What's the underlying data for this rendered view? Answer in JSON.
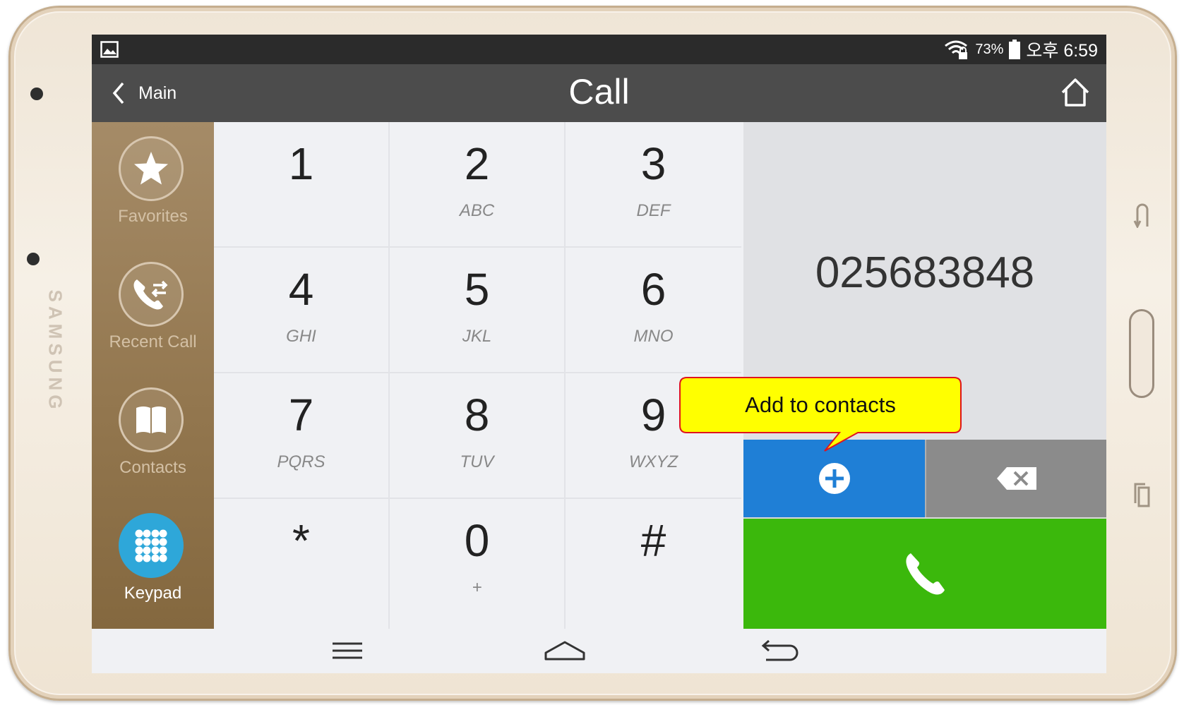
{
  "device": {
    "brand": "SAMSUNG"
  },
  "status_bar": {
    "gallery_icon": "picture-icon",
    "wifi_icon": "wifi-lock-icon",
    "battery_percent": "73%",
    "battery_icon": "battery-icon",
    "time": "오후 6:59"
  },
  "header": {
    "back_label": "Main",
    "title": "Call",
    "home_icon": "home-icon"
  },
  "sidebar": {
    "items": [
      {
        "label": "Favorites",
        "icon": "star-icon",
        "active": false
      },
      {
        "label": "Recent Call",
        "icon": "recent-call-icon",
        "active": false
      },
      {
        "label": "Contacts",
        "icon": "contacts-book-icon",
        "active": false
      },
      {
        "label": "Keypad",
        "icon": "keypad-icon",
        "active": true
      }
    ]
  },
  "keypad": {
    "keys": [
      {
        "digit": "1",
        "letters": ""
      },
      {
        "digit": "2",
        "letters": "ABC"
      },
      {
        "digit": "3",
        "letters": "DEF"
      },
      {
        "digit": "4",
        "letters": "GHI"
      },
      {
        "digit": "5",
        "letters": "JKL"
      },
      {
        "digit": "6",
        "letters": "MNO"
      },
      {
        "digit": "7",
        "letters": "PQRS"
      },
      {
        "digit": "8",
        "letters": "TUV"
      },
      {
        "digit": "9",
        "letters": "WXYZ"
      },
      {
        "digit": "*",
        "letters": ""
      },
      {
        "digit": "0",
        "letters": "+"
      },
      {
        "digit": "#",
        "letters": ""
      }
    ]
  },
  "dialer": {
    "number": "025683848",
    "add_contact_icon": "plus-circle-icon",
    "delete_icon": "backspace-icon",
    "call_icon": "phone-icon"
  },
  "callout": {
    "text": "Add to contacts"
  },
  "nav_bar": {
    "menu_icon": "menu-icon",
    "home_icon": "home-outline-icon",
    "back_icon": "back-icon"
  },
  "colors": {
    "add_button": "#1f7fd6",
    "delete_button": "#8b8b8b",
    "call_button": "#3bb80c",
    "active_sidebar": "#2ea7d9",
    "callout_fill": "#ffff00",
    "callout_border": "#e0141e"
  }
}
